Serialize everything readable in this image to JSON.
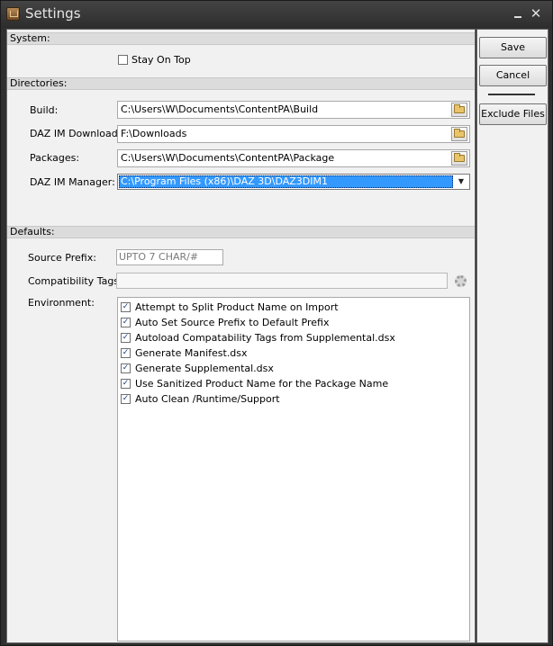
{
  "window": {
    "title": "Settings",
    "minimize_glyph": "_",
    "close_glyph": "✕"
  },
  "system": {
    "header": "System:",
    "stay_on_top_label": "Stay On Top",
    "stay_on_top_checked": false
  },
  "directories": {
    "header": "Directories:",
    "build_label": "Build:",
    "build_value": "C:\\Users\\W\\Documents\\ContentPA\\Build",
    "daz_download_label": "DAZ IM Download:",
    "daz_download_value": "F:\\Downloads",
    "packages_label": "Packages:",
    "packages_value": "C:\\Users\\W\\Documents\\ContentPA\\Package",
    "daz_manager_label": "DAZ IM Manager:",
    "daz_manager_value": "C:\\Program Files (x86)\\DAZ 3D\\DAZ3DIM1",
    "dropdown_arrow": "▼"
  },
  "defaults": {
    "header": "Defaults:",
    "source_prefix_label": "Source Prefix:",
    "source_prefix_placeholder": "UPTO 7 CHAR/#",
    "compat_tags_label": "Compatibility Tags:",
    "compat_tags_value": "",
    "environment_label": "Environment:",
    "environment_options": [
      {
        "label": "Attempt to Split Product Name on Import",
        "checked": true
      },
      {
        "label": "Auto Set Source Prefix to Default Prefix",
        "checked": true
      },
      {
        "label": "Autoload Compatability Tags from Supplemental.dsx",
        "checked": true
      },
      {
        "label": "Generate Manifest.dsx",
        "checked": true
      },
      {
        "label": "Generate Supplemental.dsx",
        "checked": true
      },
      {
        "label": "Use Sanitized Product Name for the Package Name",
        "checked": true
      },
      {
        "label": "Auto Clean /Runtime/Support",
        "checked": true
      }
    ],
    "check_glyph": "✓"
  },
  "buttons": {
    "save": "Save",
    "cancel": "Cancel",
    "exclude_files": "Exclude Files"
  },
  "icons": {
    "app": "settings-app-icon",
    "folder": "folder-icon",
    "gear": "gear-icon"
  }
}
